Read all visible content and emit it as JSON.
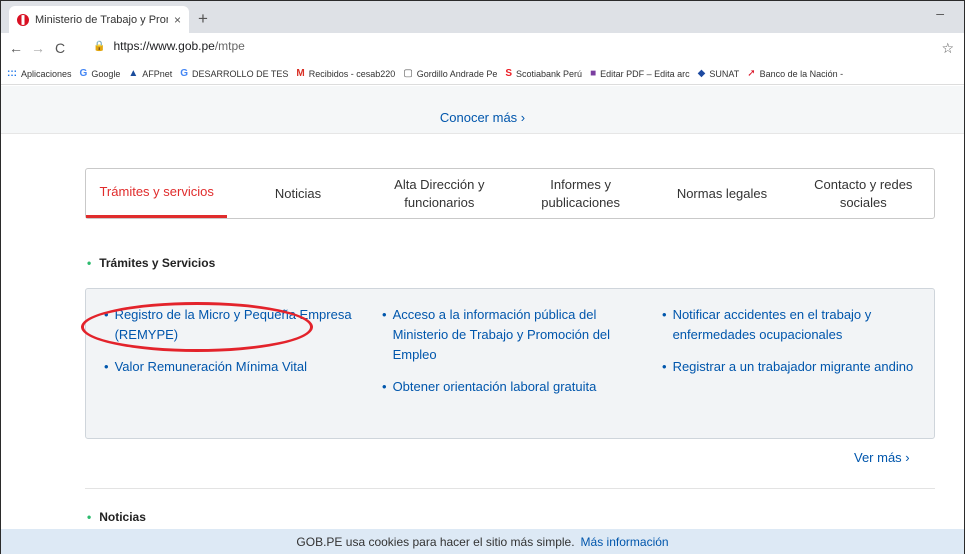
{
  "browser": {
    "tab_title": "Ministerio de Trabajo y Promoció",
    "tab_close": "×",
    "new_tab": "+",
    "minimize": "–",
    "back": "←",
    "forward": "→",
    "reload": "C",
    "url_host": "https://www.gob.pe",
    "url_path": "/mtpe",
    "star": "☆"
  },
  "bookmarks": [
    {
      "icon": ":::",
      "icon_color": "#1a73e8",
      "label": "Aplicaciones"
    },
    {
      "icon": "G",
      "icon_color": "#4285f4",
      "label": "Google"
    },
    {
      "icon": "▲",
      "icon_color": "#1a4c9c",
      "label": "AFPnet"
    },
    {
      "icon": "G",
      "icon_color": "#4285f4",
      "label": "DESARROLLO DE TES"
    },
    {
      "icon": "M",
      "icon_color": "#d93025",
      "label": "Recibidos - cesab220"
    },
    {
      "icon": "▢",
      "icon_color": "#555555",
      "label": "Gordillo Andrade Pe"
    },
    {
      "icon": "S",
      "icon_color": "#ec1c24",
      "label": "Scotiabank Perú"
    },
    {
      "icon": "■",
      "icon_color": "#7b3fa0",
      "label": "Editar PDF – Edita arc"
    },
    {
      "icon": "◆",
      "icon_color": "#1d4aa1",
      "label": "SUNAT"
    },
    {
      "icon": "➚",
      "icon_color": "#d91023",
      "label": "Banco de la Nación -"
    }
  ],
  "hero": {
    "link": "Conocer más ›"
  },
  "tabs": [
    {
      "label": "Trámites y servicios",
      "active": true
    },
    {
      "label": "Noticias",
      "active": false
    },
    {
      "label": "Alta Dirección y funcionarios",
      "active": false
    },
    {
      "label": "Informes y publicaciones",
      "active": false
    },
    {
      "label": "Normas legales",
      "active": false
    },
    {
      "label": "Contacto y redes sociales",
      "active": false
    }
  ],
  "tramites": {
    "title": "Trámites y Servicios",
    "bullet": "•",
    "col1": [
      "Registro de la Micro y Pequeña Empresa (REMYPE)",
      "Valor Remuneración Mínima Vital"
    ],
    "col2": [
      "Acceso a la información pública del Ministerio de Trabajo y Promoción del Empleo",
      "Obtener orientación laboral gratuita"
    ],
    "col3": [
      "Notificar accidentes en el trabajo y enfermedades ocupacionales",
      "Registrar a un trabajador migrante andino"
    ],
    "ver_mas": "Ver más  ›"
  },
  "noticias": {
    "title": "Noticias",
    "bullet": "•"
  },
  "cookie": {
    "text": "GOB.PE usa cookies para hacer el sitio más simple.",
    "link": "Más información"
  },
  "colors": {
    "accent_red": "#e02c2c",
    "link_blue": "#0056ac",
    "bullet_green": "#2dbb6e",
    "cookie_bg": "#dde9f5"
  }
}
